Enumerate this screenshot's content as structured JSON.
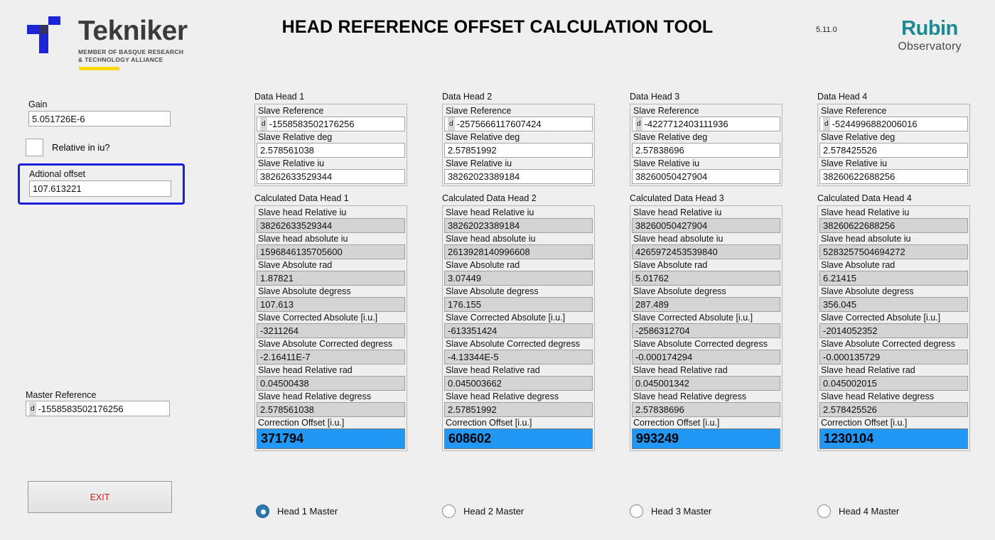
{
  "header": {
    "title": "HEAD REFERENCE OFFSET CALCULATION TOOL",
    "version": "5.11.0",
    "tekniker": {
      "wordmark": "Tekniker",
      "tagline_line1": "MEMBER OF BASQUE RESEARCH",
      "tagline_line2": "& TECHNOLOGY ALLIANCE",
      "mark_color": "#1b24d6",
      "bar_color": "#ffd900"
    },
    "rubin": {
      "name": "Rubin",
      "subtitle": "Observatory",
      "color": "#1b8a93"
    }
  },
  "left_panel": {
    "gain_label": "Gain",
    "gain_value": "5.051726E-6",
    "relative_label": "Relative in iu?",
    "relative_checked": false,
    "offset_label": "Adtional offset",
    "offset_value": "107.613221",
    "offset_highlight_color": "#1d1ddc",
    "master_reference_label": "Master Reference",
    "master_reference_prefix": "d",
    "master_reference_value": "-1558583502176256",
    "exit_label": "EXIT",
    "exit_color": "#d01c1c"
  },
  "data_field_labels": {
    "slave_reference": "Slave Reference",
    "slave_relative_deg": "Slave Relative deg",
    "slave_relative_iu": "Slave Relative iu"
  },
  "calc_field_labels": {
    "head_relative_iu": "Slave head Relative iu",
    "head_absolute_iu": "Slave head absolute iu",
    "absolute_rad": "Slave Absolute rad",
    "absolute_degress": "Slave Absolute degress",
    "corrected_absolute_iu": "Slave Corrected Absolute [i.u.]",
    "absolute_corrected_degress": "Slave Absolute Corrected degress",
    "head_relative_rad": "Slave head Relative rad",
    "head_relative_degress": "Slave head Relative degress",
    "correction_offset_iu": "Correction Offset [i.u.]"
  },
  "highlight_color": "#2196f3",
  "prefix_badge": "d",
  "columns": [
    {
      "data_title": "Data Head 1",
      "calc_title": "Calculated Data Head 1",
      "slave_reference": "-1558583502176256",
      "slave_relative_deg": "2.578561038",
      "slave_relative_iu": "38262633529344",
      "head_relative_iu": "38262633529344",
      "head_absolute_iu": "1596846135705600",
      "absolute_rad": "1.87821",
      "absolute_degress": "107.613",
      "corrected_absolute_iu": "-3211264",
      "absolute_corrected_degress": "-2.16411E-7",
      "head_relative_rad": "0.04500438",
      "head_relative_degress": "2.578561038",
      "correction_offset_iu": "371794",
      "radio_label": "Head 1 Master",
      "radio_selected": true
    },
    {
      "data_title": "Data Head 2",
      "calc_title": "Calculated Data Head 2",
      "slave_reference": "-2575666117607424",
      "slave_relative_deg": "2.57851992",
      "slave_relative_iu": "38262023389184",
      "head_relative_iu": "38262023389184",
      "head_absolute_iu": "2613928140996608",
      "absolute_rad": "3.07449",
      "absolute_degress": "176.155",
      "corrected_absolute_iu": "-613351424",
      "absolute_corrected_degress": "-4.13344E-5",
      "head_relative_rad": "0.045003662",
      "head_relative_degress": "2.57851992",
      "correction_offset_iu": "608602",
      "radio_label": "Head 2 Master",
      "radio_selected": false
    },
    {
      "data_title": "Data Head 3",
      "calc_title": "Calculated Data Head 3",
      "slave_reference": "-4227712403111936",
      "slave_relative_deg": "2.57838696",
      "slave_relative_iu": "38260050427904",
      "head_relative_iu": "38260050427904",
      "head_absolute_iu": "4265972453539840",
      "absolute_rad": "5.01762",
      "absolute_degress": "287.489",
      "corrected_absolute_iu": "-2586312704",
      "absolute_corrected_degress": "-0.000174294",
      "head_relative_rad": "0.045001342",
      "head_relative_degress": "2.57838696",
      "correction_offset_iu": "993249",
      "radio_label": "Head 3 Master",
      "radio_selected": false
    },
    {
      "data_title": "Data Head 4",
      "calc_title": "Calculated Data Head 4",
      "slave_reference": "-5244996882006016",
      "slave_relative_deg": "2.578425526",
      "slave_relative_iu": "38260622688256",
      "head_relative_iu": "38260622688256",
      "head_absolute_iu": "5283257504694272",
      "absolute_rad": "6.21415",
      "absolute_degress": "356.045",
      "corrected_absolute_iu": "-2014052352",
      "absolute_corrected_degress": "-0.000135729",
      "head_relative_rad": "0.045002015",
      "head_relative_degress": "2.578425526",
      "correction_offset_iu": "1230104",
      "radio_label": "Head 4 Master",
      "radio_selected": false
    }
  ]
}
